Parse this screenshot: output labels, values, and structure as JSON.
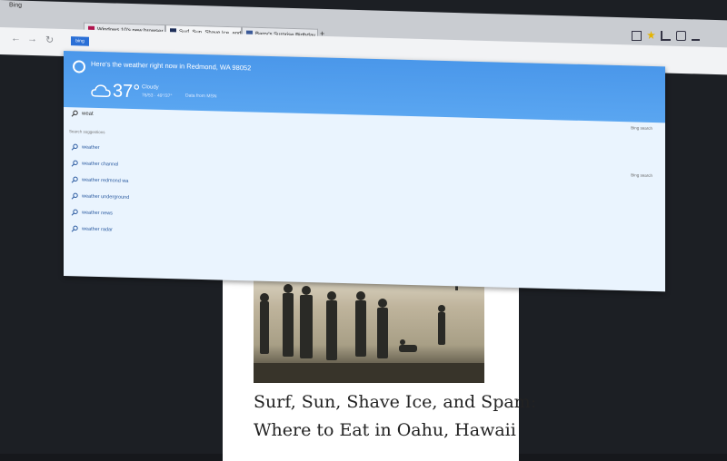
{
  "browser": {
    "app_label": "Bing",
    "tabs": [
      {
        "label": "Windows 10's new browser is ...",
        "close": "×",
        "active": false
      },
      {
        "label": "Surf, Sun, Shave Ice, and ...",
        "close": "×",
        "active": true
      },
      {
        "label": "Barry's Surprise Birthday Par...",
        "close": "×",
        "active": false
      }
    ],
    "new_tab": "+",
    "search_engine_pill": "bing"
  },
  "weather": {
    "headline": "Here's the weather right now in Redmond, WA 98052",
    "temperature": "37°",
    "condition": "Cloudy",
    "range": "76/53 · 49°/37°",
    "source": "Data from MSN"
  },
  "search": {
    "query": "weat",
    "bing_search_label": "Bing search",
    "suggestions_header": "Search suggestions",
    "suggestions": [
      "weather",
      "weather channel",
      "weather redmond wa",
      "weather underground",
      "weather news",
      "weather radar"
    ]
  },
  "article": {
    "title_line1": "Surf, Sun, Shave Ice, and Spam:",
    "title_line2": "Where to Eat in Oahu, Hawaii"
  },
  "colors": {
    "weather_bar": "#4a97ea",
    "dropdown_bg": "#eaf4fe",
    "bing_blue": "#2a6fd6"
  }
}
